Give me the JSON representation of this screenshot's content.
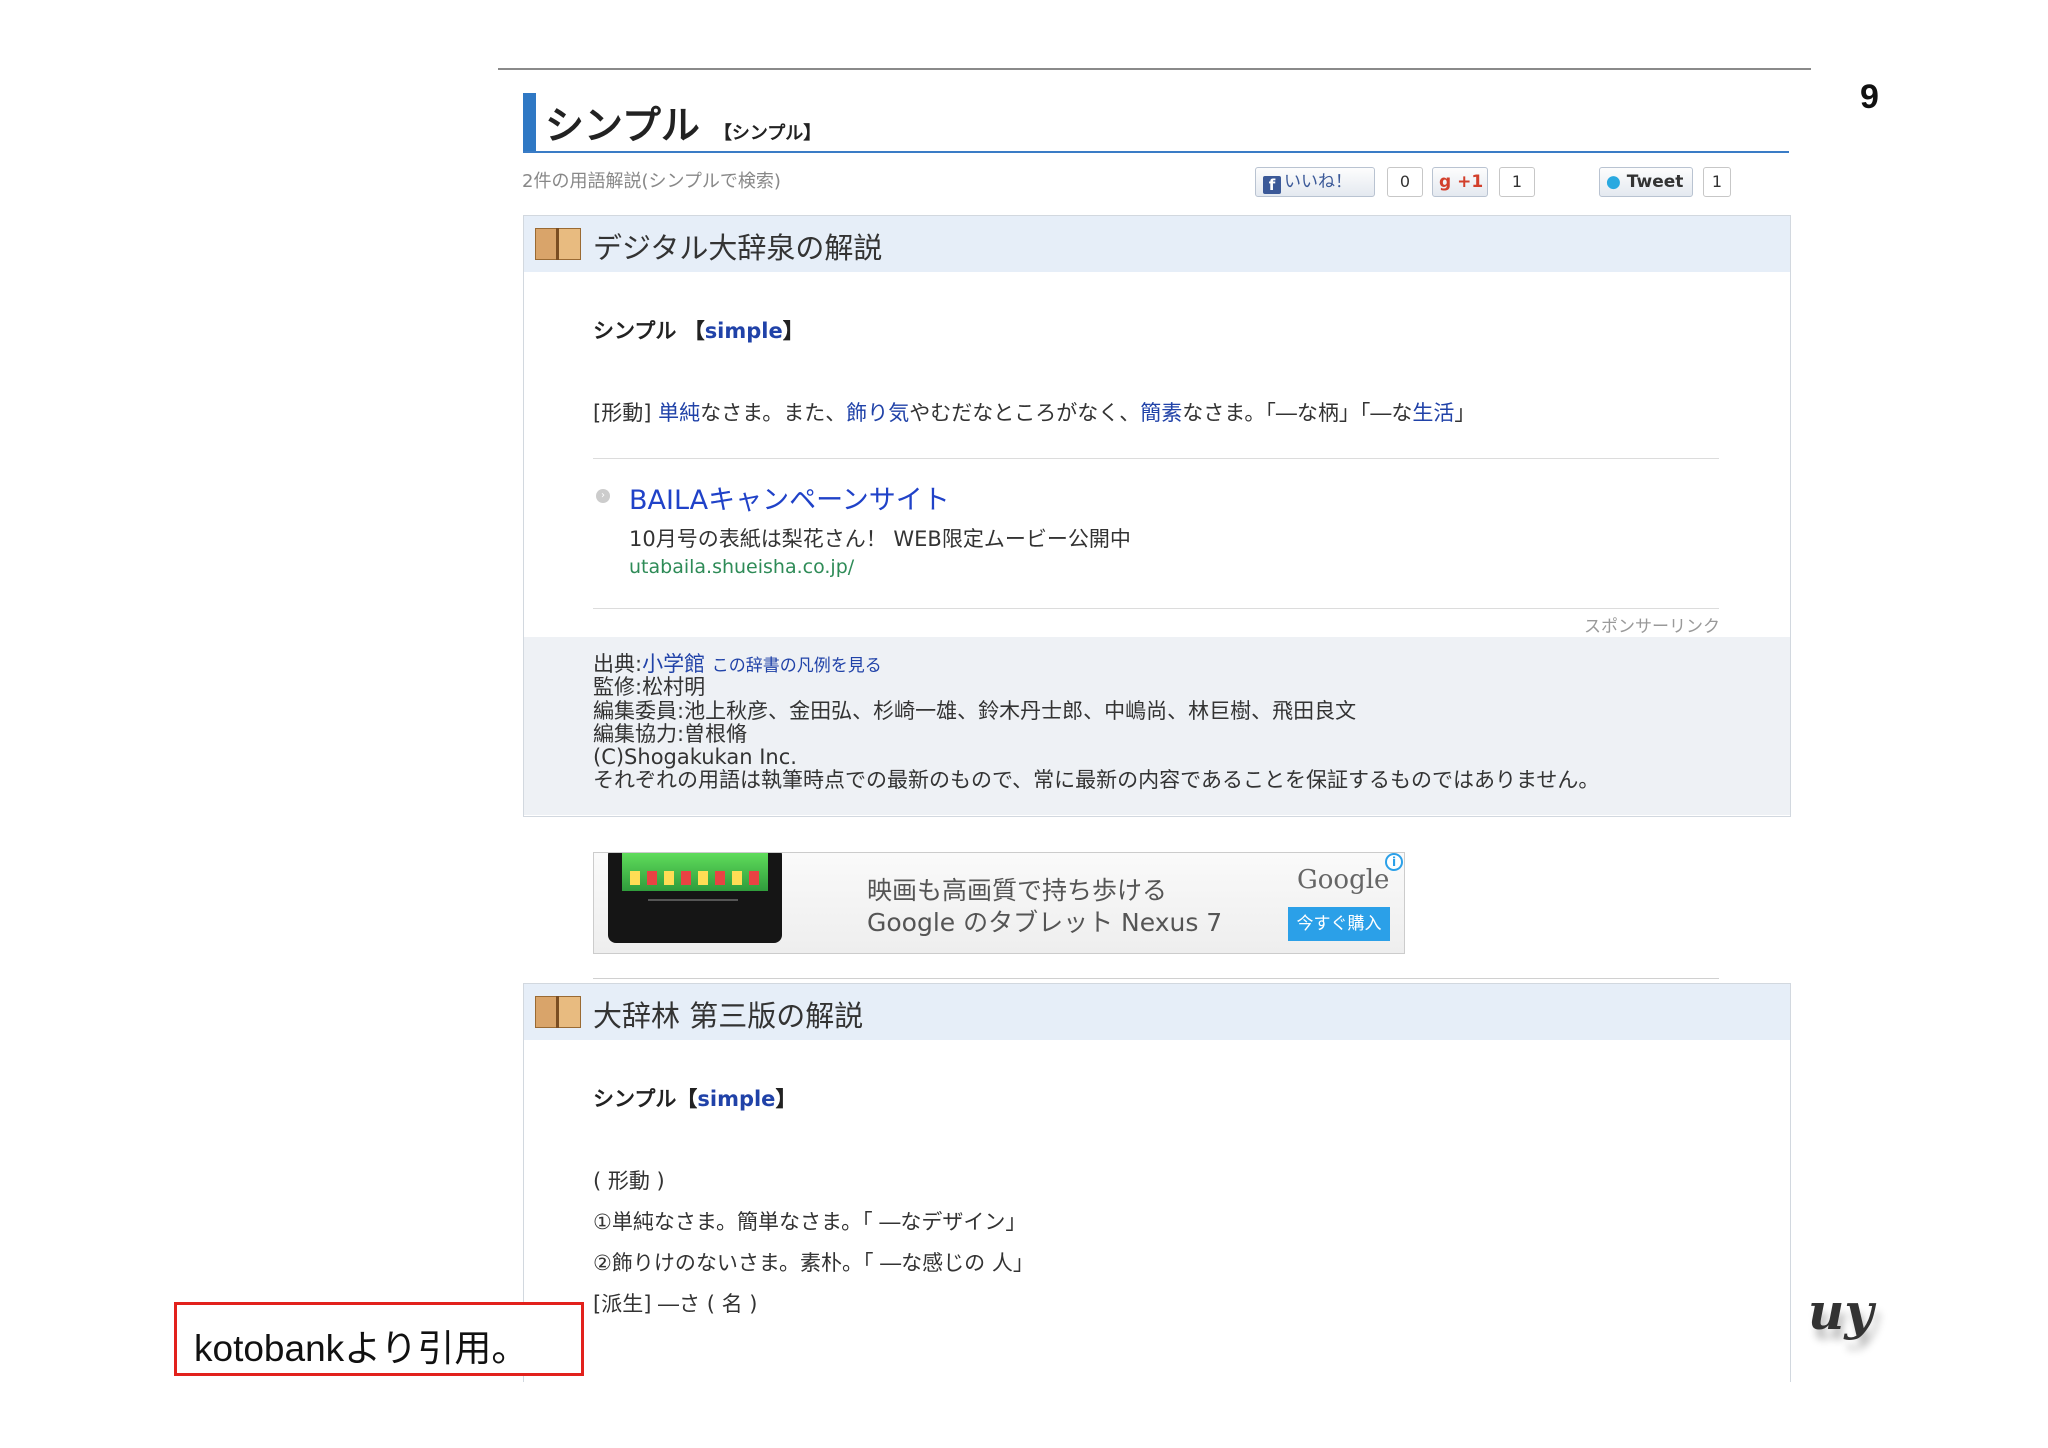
{
  "slide": {
    "page_number": "9"
  },
  "page": {
    "title": "シンプル",
    "title_reading": "【シンプル】",
    "search_summary": "2件の用語解説(シンプルで検索)"
  },
  "social": {
    "like_label": "いいね！",
    "like_count": "0",
    "gplus_label": "+1",
    "gplus_count": "1",
    "tweet_label": "Tweet",
    "tweet_count": "1"
  },
  "section1": {
    "title": "デジタル大辞泉の解説",
    "headword": "シンプル",
    "bracket_open": "【",
    "headword_en": "simple",
    "bracket_close": "】",
    "definition": {
      "pos": "[形動]",
      "link1": "単純",
      "text1": "なさま。また、",
      "link2": "飾り気",
      "text2": "やむだなところがなく、",
      "link3": "簡素",
      "text3": "なさま。「―な柄」「―な",
      "link4": "生活",
      "text4": "」"
    },
    "ad": {
      "title": "BAILAキャンペーンサイト",
      "description": "10月号の表紙は梨花さん！ WEB限定ムービー公開中",
      "url": "utabaila.shueisha.co.jp/",
      "sponsor_label": "スポンサーリンク"
    },
    "credits": {
      "source_label": "出典:",
      "source_link": "小学館",
      "legend_link": "この辞書の凡例を見る",
      "supervisor": "監修:松村明",
      "editors": "編集委員:池上秋彦、金田弘、杉崎一雄、鈴木丹士郎、中嶋尚、林巨樹、飛田良文",
      "cooperation": "編集協力:曽根脩",
      "copyright": "(C)Shogakukan Inc.",
      "disclaimer": "それぞれの用語は執筆時点での最新のもので、常に最新の内容であることを保証するものではありません。"
    }
  },
  "banner": {
    "line1": "映画も高画質で持ち歩ける",
    "line2": "Google のタブレット Nexus 7",
    "logo": "Google",
    "button": "今すぐ購入",
    "info": "i"
  },
  "section2": {
    "title": "大辞林 第三版の解説",
    "headword": "シンプル",
    "bracket_open": "【",
    "headword_en": "simple",
    "bracket_close": "】",
    "lines": [
      "( 形動 )",
      "①単純なさま。簡単なさま。「 ―なデザイン」",
      "②飾りけのないさま。素朴。「 ―な感じの 人」",
      "[派生] ―さ ( 名 )"
    ]
  },
  "annotation": {
    "quote": "kotobankより引用。"
  },
  "logo_mark": {
    "text": "uy"
  }
}
